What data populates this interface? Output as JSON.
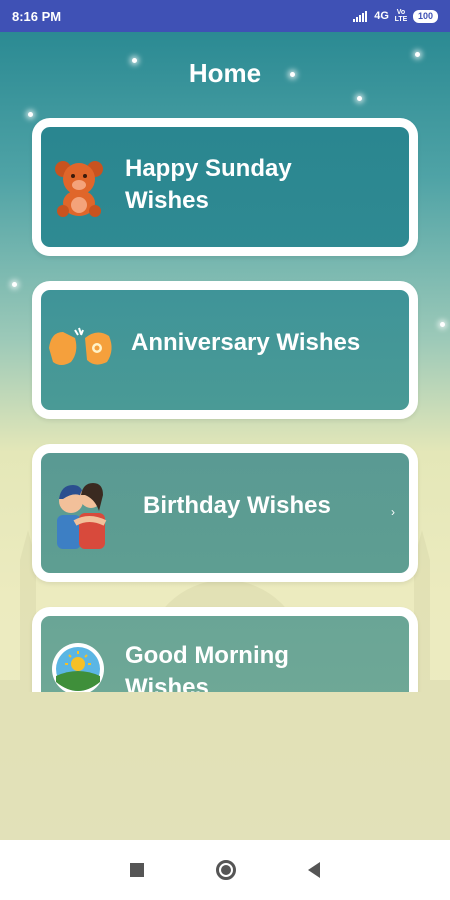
{
  "status_bar": {
    "time": "8:16 PM",
    "network": "4G",
    "volte_line1": "Vo",
    "volte_line2": "LTE",
    "battery": "100"
  },
  "header": {
    "title": "Home"
  },
  "cards": [
    {
      "line1": "Happy Sunday",
      "line2": "Wishes",
      "icon": "teddy-bear-icon"
    },
    {
      "line1": "Anniversary Wishes",
      "icon": "clapping-hands-icon"
    },
    {
      "line1": "Birthday Wishes",
      "icon": "friends-hug-icon",
      "chevron": "›"
    },
    {
      "line1": "Good Morning",
      "line2": "Wishes",
      "icon": "sun-landscape-icon"
    }
  ],
  "colors": {
    "status_bar": "#3f51b5",
    "card_top": "#2f8a92",
    "card_mid": "#54998f",
    "card_border": "#ffffff"
  },
  "nav": {
    "icons": [
      "recents-square-icon",
      "home-circle-icon",
      "back-triangle-icon"
    ]
  }
}
